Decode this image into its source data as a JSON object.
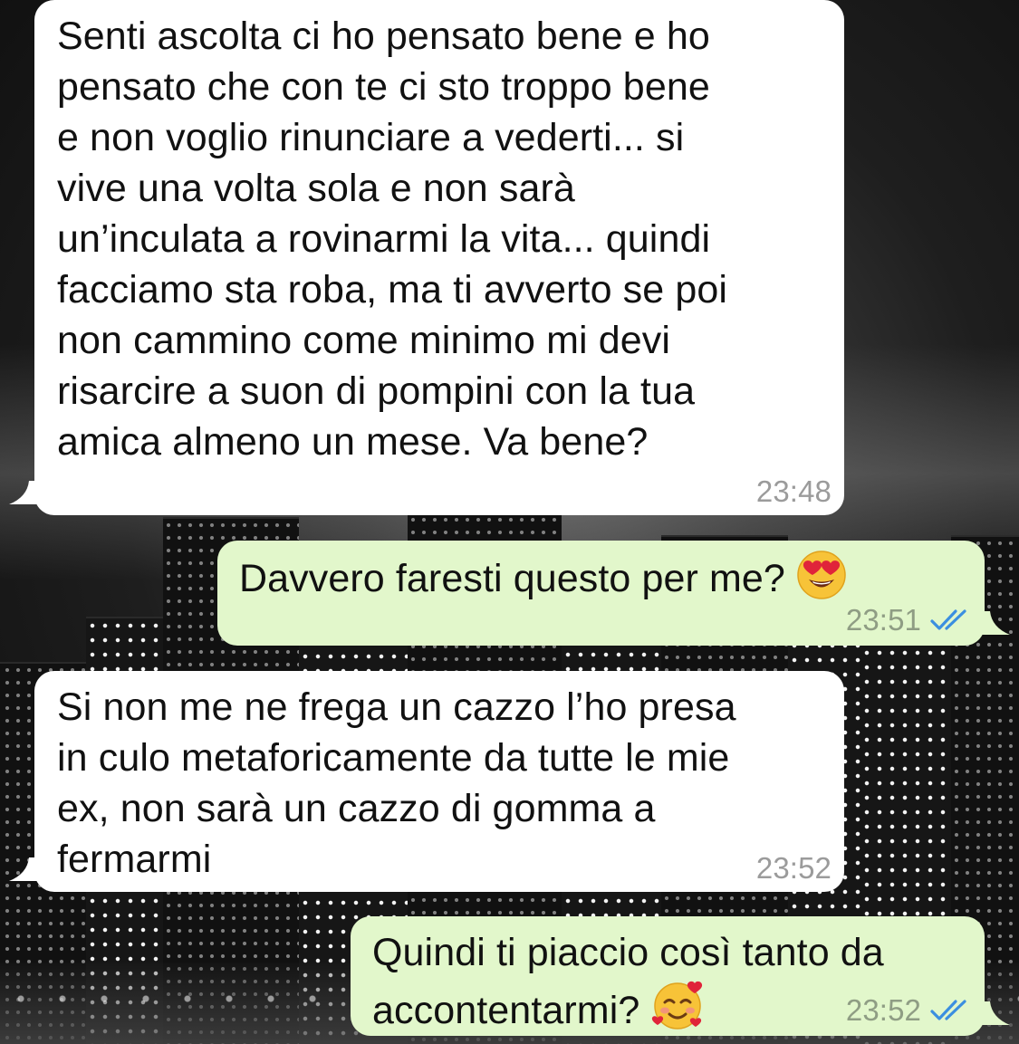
{
  "conversation": {
    "messages": [
      {
        "direction": "incoming",
        "text": "Senti ascolta ci ho pensato bene e ho\npensato che con te ci sto troppo bene\ne non voglio rinunciare a vederti... si\nvive una volta sola e non sarà\nun’inculata a rovinarmi la vita... quindi\nfacciamo sta roba, ma ti avverto se poi\nnon cammino come minimo mi devi\nrisarcire a suon di pompini con la tua\namica almeno un mese. Va bene?",
        "time": "23:48"
      },
      {
        "direction": "outgoing",
        "text": "Davvero faresti questo per me? ",
        "emoji": "smiling-face-with-heart-eyes",
        "time": "23:51",
        "status": "read"
      },
      {
        "direction": "incoming",
        "text": "Si non me ne frega un cazzo l’ho presa\nin culo metaforicamente da tutte le mie\nex, non sarà un cazzo di gomma a\nfermarmi",
        "time": "23:52"
      },
      {
        "direction": "outgoing",
        "text": "Quindi ti piaccio così tanto da\naccontentarmi? ",
        "emoji": "smiling-face-with-hearts",
        "time": "23:52",
        "status": "read"
      }
    ]
  },
  "colors": {
    "incoming_bubble": "#ffffff",
    "outgoing_bubble": "#e2f7cb",
    "read_ticks": "#3b8fe0",
    "timestamp": "#9b9b9b"
  }
}
